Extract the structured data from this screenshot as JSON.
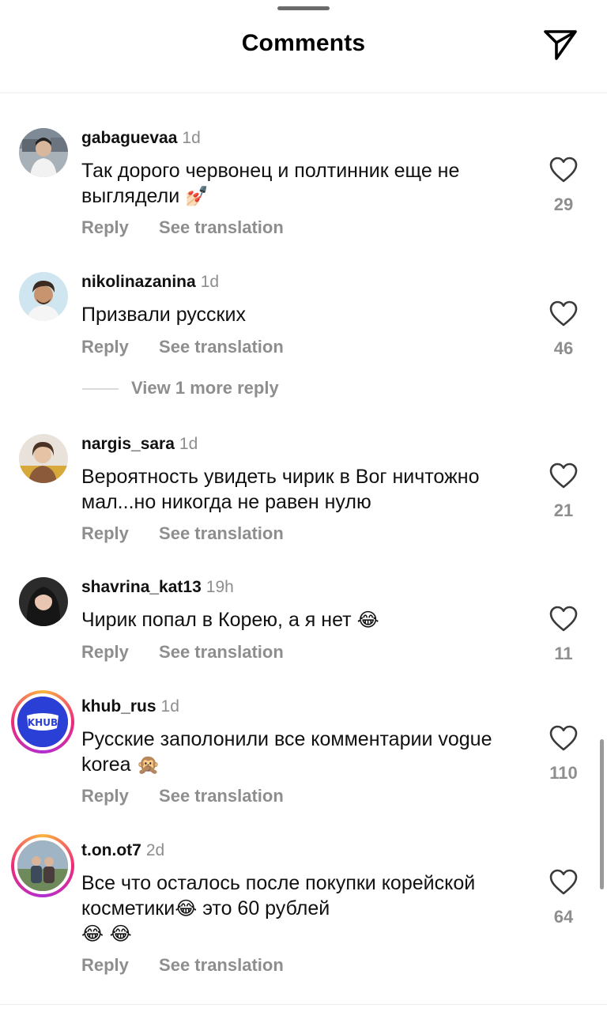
{
  "header": {
    "title": "Comments"
  },
  "icons": {
    "share": "paper-plane-icon",
    "heart": "heart-outline-icon"
  },
  "colors": {
    "muted": "#8e8e8e",
    "ring_start": "#f9b53e",
    "ring_mid": "#ee2a7b",
    "ring_end": "#b02fd0"
  },
  "comments": [
    {
      "username": "gabaguevaa",
      "time": "1d",
      "text": "Так дорого червонец и полтинник еще не выглядели",
      "emoji": "💅🏻",
      "likes": "29",
      "reply_label": "Reply",
      "translate_label": "See translation"
    },
    {
      "username": "nikolinazanina",
      "time": "1d",
      "text": "Призвали русских",
      "emoji": "",
      "likes": "46",
      "reply_label": "Reply",
      "translate_label": "See translation",
      "view_more": "View 1 more reply"
    },
    {
      "username": "nargis_sara",
      "time": "1d",
      "text": "Вероятность увидеть чирик в Вог ничтожно мал...но никогда не равен нулю",
      "emoji": "",
      "likes": "21",
      "reply_label": "Reply",
      "translate_label": "See translation"
    },
    {
      "username": "shavrina_kat13",
      "time": "19h",
      "text": "Чирик попал в Корею, а я нет",
      "emoji": "😂",
      "likes": "11",
      "reply_label": "Reply",
      "translate_label": "See translation"
    },
    {
      "username": "khub_rus",
      "time": "1d",
      "text": "Русские заполонили все комментарии vogue korea",
      "emoji": "🙊",
      "likes": "110",
      "reply_label": "Reply",
      "translate_label": "See translation",
      "avatar_logo": "KHUB"
    },
    {
      "username": "t.on.ot7",
      "time": "2d",
      "text": "Все что осталось после покупки корейской косметики",
      "text_tail": " это 60 рублей",
      "emoji": "😂",
      "emoji_tail": "😂 😂",
      "likes": "64",
      "reply_label": "Reply",
      "translate_label": "See translation"
    }
  ]
}
